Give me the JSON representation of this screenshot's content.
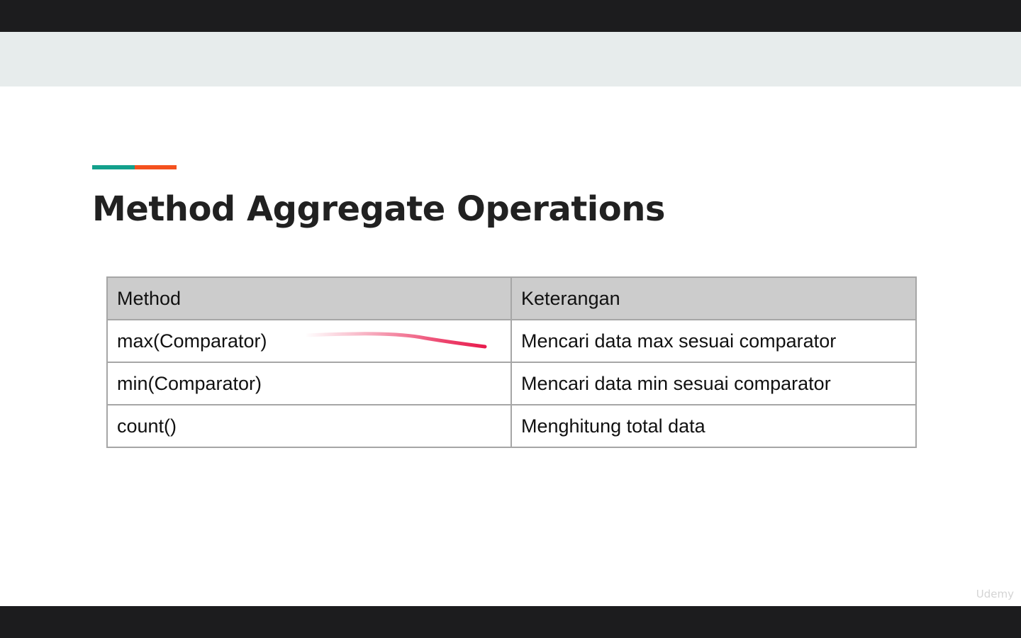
{
  "colors": {
    "accent_teal": "#13a08c",
    "accent_orange": "#f4511e",
    "annotation": "#e8174a"
  },
  "slide": {
    "title": "Method Aggregate Operations",
    "table": {
      "headers": [
        "Method",
        "Keterangan"
      ],
      "rows": [
        [
          "max(Comparator)",
          "Mencari data max sesuai comparator"
        ],
        [
          "min(Comparator)",
          "Mencari data min sesuai comparator"
        ],
        [
          "count()",
          "Menghitung total data"
        ]
      ]
    }
  },
  "watermark": "Udemy"
}
